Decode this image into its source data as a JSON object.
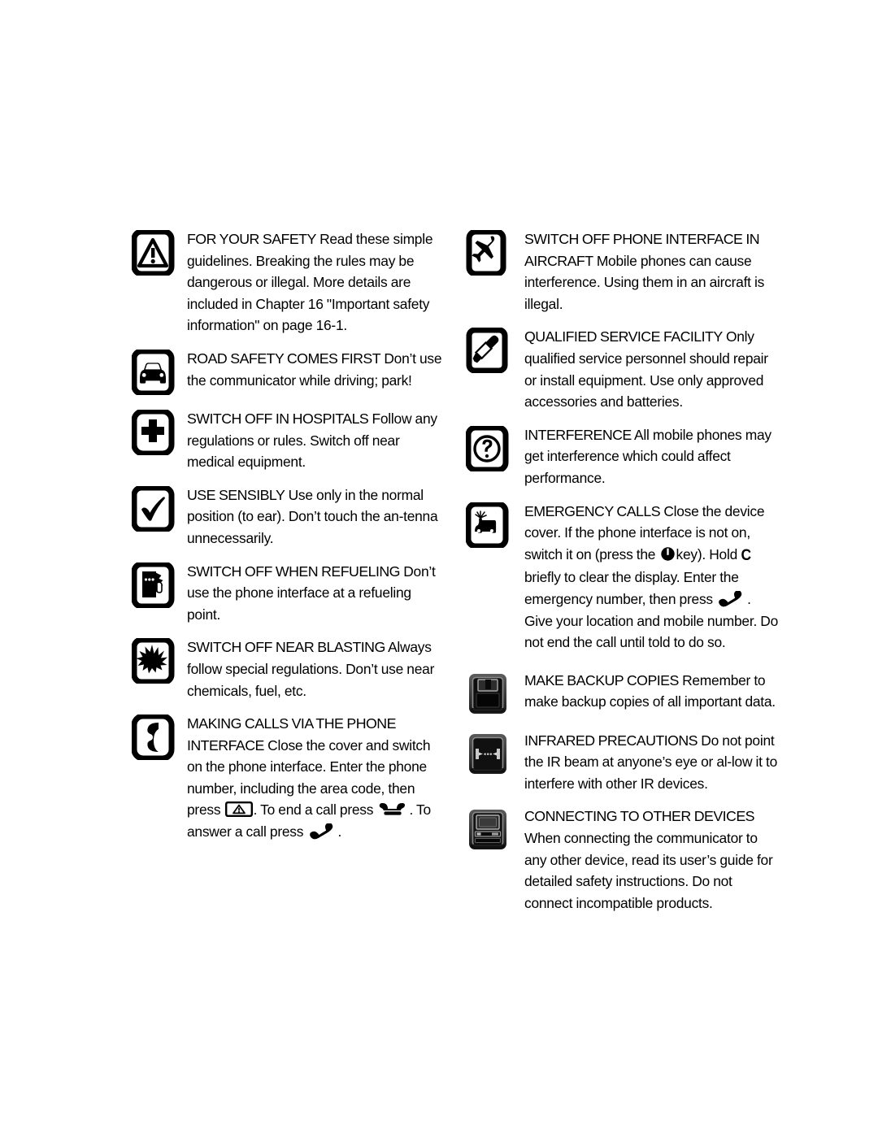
{
  "document": {
    "title": "For Your Safety",
    "layout": "two-column",
    "page_background": "#ffffff",
    "text_color": "#000000"
  },
  "left_column": [
    {
      "icon": "warning-triangle-icon",
      "heading": "FOR YOUR SAFETY",
      "body": "Read these simple guidelines. Breaking the rules may be dangerous or illegal. More details are included in Chapter 16 \"Important safety information\" on page 16-1."
    },
    {
      "icon": "car-icon",
      "heading": "ROAD SAFETY COMES FIRST",
      "body": "Don’t use the communicator while driving; park!"
    },
    {
      "icon": "hospital-cross-icon",
      "heading": "SWITCH OFF IN HOSPITALS",
      "body": "Follow any regulations or rules. Switch off near medical equipment."
    },
    {
      "icon": "checkmark-icon",
      "heading": "USE SENSIBLY",
      "body": "Use only in the normal position (to ear). Don’t touch the an-tenna unnecessarily."
    },
    {
      "icon": "fuel-pump-icon",
      "heading": "SWITCH OFF WHEN REFUELING",
      "body": "Don’t use the phone interface at a refueling point."
    },
    {
      "icon": "blasting-explosion-icon",
      "heading": "SWITCH OFF NEAR BLASTING",
      "body": "Always follow special regulations. Don’t use near chemicals, fuel, etc."
    },
    {
      "icon": "phone-handset-icon",
      "heading": "MAKING CALLS VIA THE PHONE INTERFACE",
      "body_part_1": "Close the cover and switch on the phone interface. Enter the phone number, including the area code, then press",
      "inline_glyph_1": "send-key-icon",
      "body_part_2": ". To end a call press",
      "inline_glyph_2": "end-call-icon",
      "body_part_3": ". To answer a call press",
      "inline_glyph_3": "answer-call-icon",
      "body_part_4": "."
    }
  ],
  "right_column": [
    {
      "icon": "airplane-icon",
      "heading": "SWITCH OFF PHONE INTERFACE IN AIRCRAFT",
      "body": "Mobile phones can cause interference. Using them in an aircraft is illegal."
    },
    {
      "icon": "screwdriver-icon",
      "heading": "QUALIFIED SERVICE FACILITY",
      "body": "Only qualified service personnel should repair or install equipment. Use only approved accessories and batteries."
    },
    {
      "icon": "question-mark-icon",
      "heading": "INTERFERENCE",
      "body": "All mobile phones may get interference which could affect performance."
    },
    {
      "icon": "emergency-vehicle-icon",
      "heading": "EMERGENCY CALLS",
      "body_part_1": "Close the device cover. If the phone interface is not on, switch it on (press the",
      "inline_glyph_1": "power-key-icon",
      "body_part_2": "key). Hold",
      "inline_glyph_2": "clear-key-c",
      "inline_glyph_2_text": "C",
      "body_part_3": "briefly to clear the display. Enter the emergency number, then press",
      "inline_glyph_3": "answer-call-icon",
      "body_part_4": ". Give your location and mobile number. Do not end the call until told to do so."
    },
    {
      "icon": "floppy-disk-icon",
      "heading": "MAKE BACKUP COPIES",
      "body": "Remember to make backup copies of all important data."
    },
    {
      "icon": "infrared-port-icon",
      "heading": "INFRARED PRECAUTIONS",
      "body": "Do not point the IR beam at anyone’s eye or al-low it to interfere with other IR devices."
    },
    {
      "icon": "connect-devices-icon",
      "heading": "CONNECTING TO OTHER DEVICES",
      "body": "When connecting the communicator to any other device, read its user’s guide for detailed safety instructions. Do not connect incompatible products."
    }
  ]
}
